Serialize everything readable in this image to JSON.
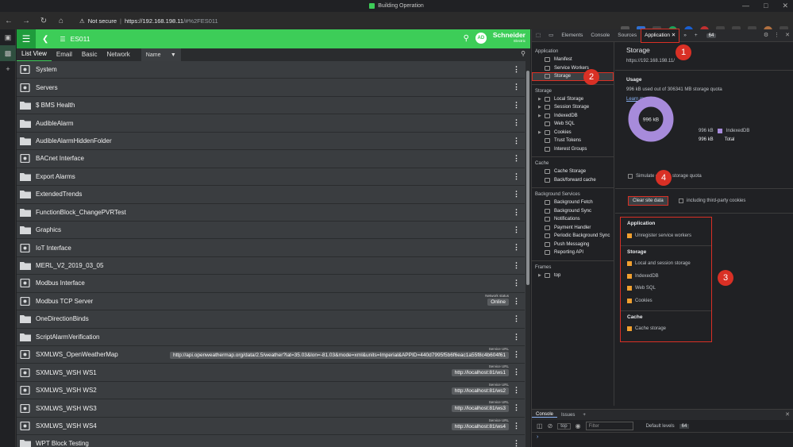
{
  "window": {
    "title": "Building Operation"
  },
  "address": {
    "not_secure": "Not secure",
    "url_scheme": "https://",
    "url_host": "192.168.198.11",
    "url_path": "/#%2FES011"
  },
  "app": {
    "header": {
      "title": "ES011",
      "avatar": "AD",
      "logo_main": "Schneider",
      "logo_sub": "Electric"
    },
    "tabs": [
      "List View",
      "Email",
      "Basic",
      "Network"
    ],
    "sort_dropdown": "Name",
    "rows": [
      {
        "label": "System",
        "icon": "system-icon"
      },
      {
        "label": "Servers",
        "icon": "server-icon"
      },
      {
        "label": "$ BMS Health",
        "icon": "folder-icon"
      },
      {
        "label": "AudibleAlarm",
        "icon": "folder-icon"
      },
      {
        "label": "AudibleAlarmHiddenFolder",
        "icon": "folder-icon"
      },
      {
        "label": "BACnet Interface",
        "icon": "bacnet-icon"
      },
      {
        "label": "Export Alarms",
        "icon": "folder-icon"
      },
      {
        "label": "ExtendedTrends",
        "icon": "folder-icon"
      },
      {
        "label": "FunctionBlock_ChangePVRTest",
        "icon": "folder-icon"
      },
      {
        "label": "Graphics",
        "icon": "folder-icon"
      },
      {
        "label": "IoT Interface",
        "icon": "iot-icon"
      },
      {
        "label": "MERL_V2_2019_03_05",
        "icon": "folder-icon"
      },
      {
        "label": "Modbus Interface",
        "icon": "modbus-icon"
      },
      {
        "label": "Modbus TCP Server",
        "icon": "modbus-icon",
        "meta_title": "Network status",
        "meta_value": "Online"
      },
      {
        "label": "OneDirectionBinds",
        "icon": "folder-icon"
      },
      {
        "label": "ScriptAlarmVerification",
        "icon": "folder-icon"
      },
      {
        "label": "SXMLWS_OpenWeatherMap",
        "icon": "ws-icon",
        "meta_title": "Service URL",
        "meta_value": "http://api.openweathermap.org/data/2.5/weather?lat=35.03&lon=-81.03&mode=xml&units=Imperial&APPID=440d7995f5b6f6eac1a55f8c4b604f61"
      },
      {
        "label": "SXMLWS_WSH WS1",
        "icon": "ws-icon",
        "meta_title": "Service URL",
        "meta_value": "http://localhost:81/ws1"
      },
      {
        "label": "SXMLWS_WSH WS2",
        "icon": "ws-icon",
        "meta_title": "Service URL",
        "meta_value": "http://localhost:81/ws2"
      },
      {
        "label": "SXMLWS_WSH WS3",
        "icon": "ws-icon",
        "meta_title": "Service URL",
        "meta_value": "http://localhost:81/ws3"
      },
      {
        "label": "SXMLWS_WSH WS4",
        "icon": "ws-icon",
        "meta_title": "Service URL",
        "meta_value": "http://localhost:81/ws4"
      },
      {
        "label": "WPT Block Testing",
        "icon": "folder-icon"
      }
    ]
  },
  "devtools": {
    "tabs": [
      "Elements",
      "Console",
      "Sources",
      "Application"
    ],
    "issues_count": "64",
    "tree": {
      "application_header": "Application",
      "application_items": [
        "Manifest",
        "Service Workers",
        "Storage"
      ],
      "storage_header": "Storage",
      "storage_items": [
        "Local Storage",
        "Session Storage",
        "IndexedDB",
        "Web SQL",
        "Cookies",
        "Trust Tokens",
        "Interest Groups"
      ],
      "cache_header": "Cache",
      "cache_items": [
        "Cache Storage",
        "Back/forward cache"
      ],
      "bg_header": "Background Services",
      "bg_items": [
        "Background Fetch",
        "Background Sync",
        "Notifications",
        "Payment Handler",
        "Periodic Background Sync",
        "Push Messaging",
        "Reporting API"
      ],
      "frames_header": "Frames",
      "frames_items": [
        "top"
      ]
    },
    "storage": {
      "title": "Storage",
      "origin": "https://192.168.198.11/",
      "usage_header": "Usage",
      "quota_text": "996 kB used out of 306341 MB storage quota",
      "learn_more": "Learn more",
      "donut_label": "996 kB",
      "legend_value": "996 kB",
      "legend_name": "IndexedDB",
      "total_value": "996 kB",
      "total_label": "Total",
      "simulate": "Simulate custom storage quota",
      "clear_button": "Clear site data",
      "third_party": "including third-party cookies",
      "sections": [
        {
          "header": "Application",
          "options": [
            "Unregister service workers"
          ]
        },
        {
          "header": "Storage",
          "options": [
            "Local and session storage",
            "IndexedDB",
            "Web SQL",
            "Cookies"
          ]
        },
        {
          "header": "Cache",
          "options": [
            "Cache storage"
          ]
        }
      ]
    },
    "console": {
      "tabs": [
        "Console",
        "Issues"
      ],
      "context": "top",
      "filter_placeholder": "Filter",
      "levels": "Default levels",
      "count": "64"
    }
  },
  "badges": [
    "1",
    "2",
    "3",
    "4"
  ],
  "colors": {
    "brand_green": "#3dcd58",
    "annotation_red": "#d93025",
    "donut_purple": "#a78bdb"
  }
}
